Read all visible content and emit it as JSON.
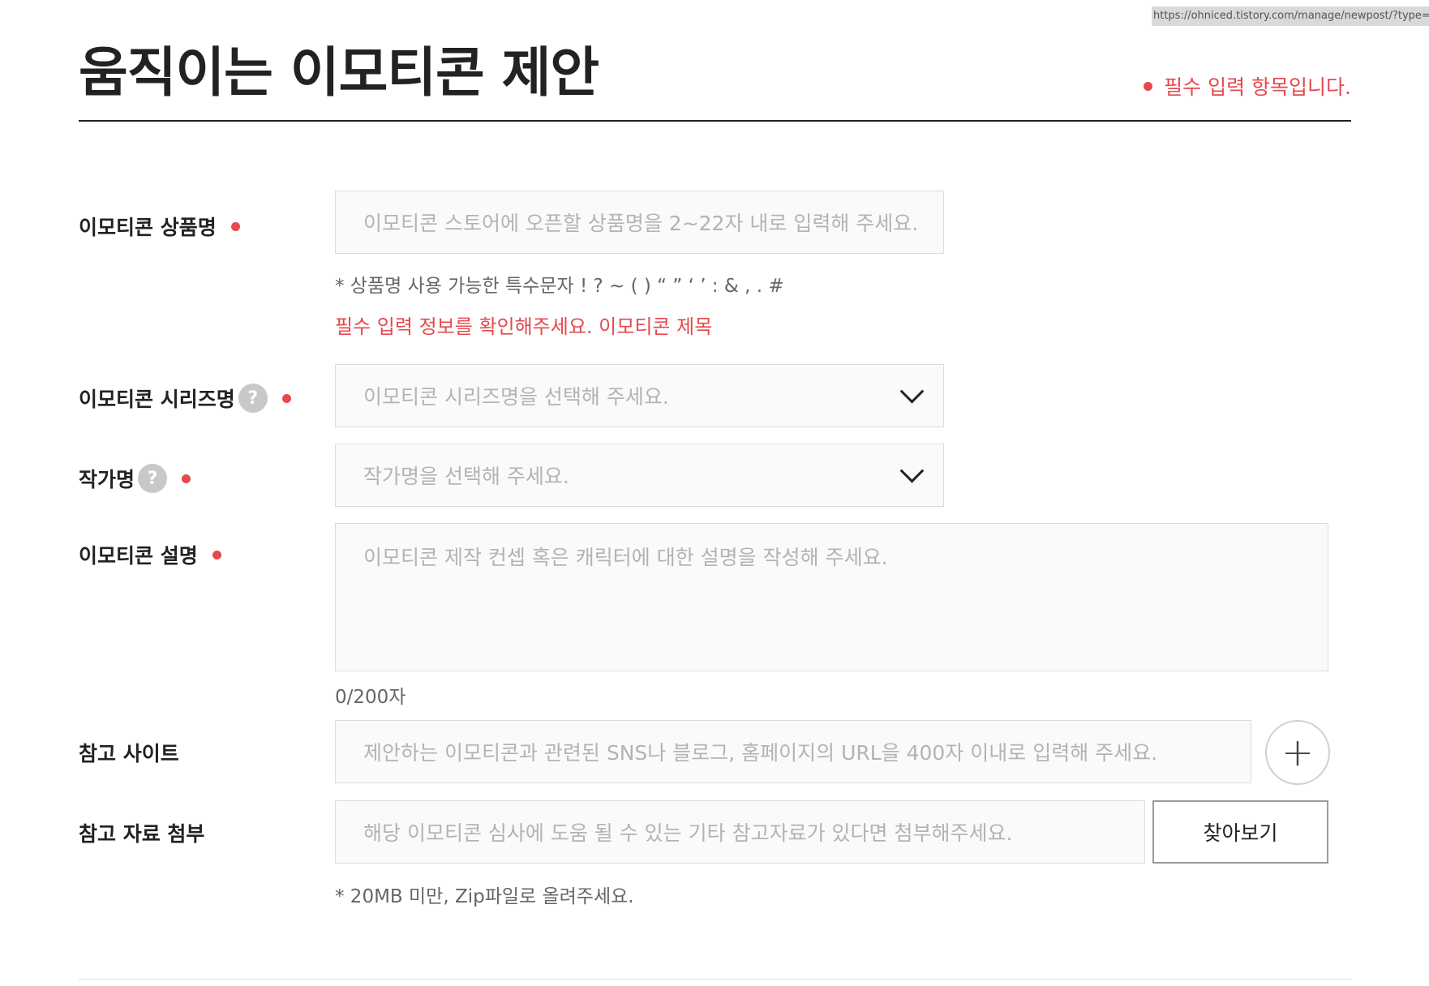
{
  "browser": {
    "url": "https://ohniced.tistory.com/manage/newpost/?type=p"
  },
  "header": {
    "title": "움직이는 이모티콘 제안",
    "required_note": "필수 입력 항목입니다."
  },
  "form": {
    "product_name": {
      "label": "이모티콘 상품명",
      "placeholder": "이모티콘 스토어에 오픈할 상품명을 2~22자 내로 입력해 주세요.",
      "hint": "* 상품명 사용 가능한 특수문자 ! ? ~ ( ) “ ” ‘ ’ : & , . #",
      "error": "필수 입력 정보를 확인해주세요. 이모티콘 제목"
    },
    "series_name": {
      "label": "이모티콘 시리즈명",
      "help": "?",
      "placeholder": "이모티콘 시리즈명을 선택해 주세요."
    },
    "author_name": {
      "label": "작가명",
      "help": "?",
      "placeholder": "작가명을 선택해 주세요."
    },
    "description": {
      "label": "이모티콘 설명",
      "placeholder": "이모티콘 제작 컨셉 혹은 캐릭터에 대한 설명을 작성해 주세요.",
      "counter": "0/200자"
    },
    "reference_site": {
      "label": "참고 사이트",
      "placeholder": "제안하는 이모티콘과 관련된 SNS나 블로그, 홈페이지의 URL을 400자 이내로 입력해 주세요.",
      "add_label": "+"
    },
    "attachment": {
      "label": "참고 자료 첨부",
      "placeholder": "해당 이모티콘 심사에 도움 될 수 있는 기타 참고자료가 있다면 첨부해주세요.",
      "browse_label": "찾아보기",
      "hint": "* 20MB 미만, Zip파일로 올려주세요."
    }
  },
  "colors": {
    "accent_red": "#e5484d",
    "text": "#222222",
    "placeholder": "#b3b3b3",
    "field_bg": "#fafafa"
  }
}
